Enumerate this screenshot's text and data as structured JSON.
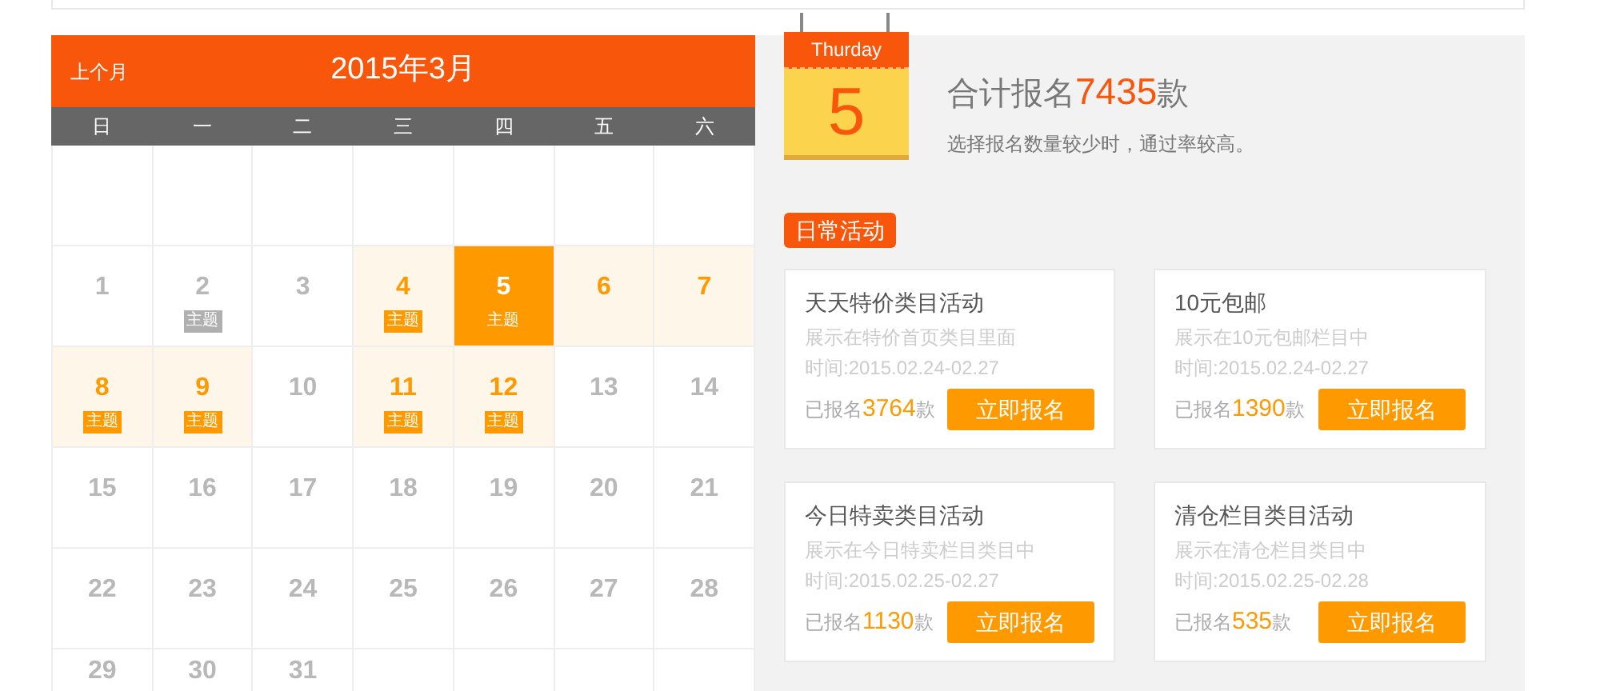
{
  "calendar": {
    "prev_link": "上个月",
    "month_title": "2015年3月",
    "weekdays": [
      "日",
      "一",
      "二",
      "三",
      "四",
      "五",
      "六"
    ],
    "weeks": [
      [
        {
          "kind": "blank"
        },
        {
          "kind": "blank"
        },
        {
          "kind": "blank"
        },
        {
          "kind": "blank"
        },
        {
          "kind": "blank"
        },
        {
          "kind": "blank"
        },
        {
          "kind": "blank"
        }
      ],
      [
        {
          "kind": "day",
          "day": "1",
          "open": false,
          "selected": false
        },
        {
          "kind": "day",
          "day": "2",
          "open": false,
          "selected": false,
          "tag": "主题"
        },
        {
          "kind": "day",
          "day": "3",
          "open": false,
          "selected": false
        },
        {
          "kind": "day",
          "day": "4",
          "open": true,
          "selected": false,
          "tag": "主题"
        },
        {
          "kind": "day",
          "day": "5",
          "selected": true,
          "tag": "主题"
        },
        {
          "kind": "day",
          "day": "6",
          "open": true,
          "selected": false
        },
        {
          "kind": "day",
          "day": "7",
          "open": true,
          "selected": false
        }
      ],
      [
        {
          "kind": "day",
          "day": "8",
          "open": true,
          "selected": false,
          "tag": "主题"
        },
        {
          "kind": "day",
          "day": "9",
          "open": true,
          "selected": false,
          "tag": "主题"
        },
        {
          "kind": "day",
          "day": "10",
          "open": false,
          "selected": false
        },
        {
          "kind": "day",
          "day": "11",
          "open": true,
          "selected": false,
          "tag": "主题"
        },
        {
          "kind": "day",
          "day": "12",
          "open": true,
          "selected": false,
          "tag": "主题"
        },
        {
          "kind": "day",
          "day": "13",
          "open": false,
          "selected": false
        },
        {
          "kind": "day",
          "day": "14",
          "open": false,
          "selected": false
        }
      ],
      [
        {
          "kind": "day",
          "day": "15",
          "open": false,
          "selected": false
        },
        {
          "kind": "day",
          "day": "16",
          "open": false,
          "selected": false
        },
        {
          "kind": "day",
          "day": "17",
          "open": false,
          "selected": false
        },
        {
          "kind": "day",
          "day": "18",
          "open": false,
          "selected": false
        },
        {
          "kind": "day",
          "day": "19",
          "open": false,
          "selected": false
        },
        {
          "kind": "day",
          "day": "20",
          "open": false,
          "selected": false
        },
        {
          "kind": "day",
          "day": "21",
          "open": false,
          "selected": false
        }
      ],
      [
        {
          "kind": "day",
          "day": "22",
          "open": false,
          "selected": false
        },
        {
          "kind": "day",
          "day": "23",
          "open": false,
          "selected": false
        },
        {
          "kind": "day",
          "day": "24",
          "open": false,
          "selected": false
        },
        {
          "kind": "day",
          "day": "25",
          "open": false,
          "selected": false
        },
        {
          "kind": "day",
          "day": "26",
          "open": false,
          "selected": false
        },
        {
          "kind": "day",
          "day": "27",
          "open": false,
          "selected": false
        },
        {
          "kind": "day",
          "day": "28",
          "open": false,
          "selected": false
        }
      ],
      [
        {
          "kind": "day",
          "day": "29",
          "open": false,
          "selected": false
        },
        {
          "kind": "day",
          "day": "30",
          "open": false,
          "selected": false
        },
        {
          "kind": "day",
          "day": "31",
          "open": false,
          "selected": false
        },
        {
          "kind": "blank"
        },
        {
          "kind": "blank"
        },
        {
          "kind": "blank"
        },
        {
          "kind": "blank"
        }
      ]
    ]
  },
  "summary": {
    "date_badge": {
      "weekday": "Thurday",
      "day": "5"
    },
    "total_label": "合计报名",
    "total_count": "7435",
    "total_unit": "款",
    "hint": "选择报名数量较少时，通过率较高。"
  },
  "section_title": "日常活动",
  "activities": [
    {
      "title": "天天特价类目活动",
      "description": "展示在特价首页类目里面",
      "time": "时间:2015.02.24-02.27",
      "signed_label": "已报名",
      "count": "3764",
      "unit": "款",
      "button": "立即报名"
    },
    {
      "title": "10元包邮",
      "description": "展示在10元包邮栏目中",
      "time": "时间:2015.02.24-02.27",
      "signed_label": "已报名",
      "count": "1390",
      "unit": "款",
      "button": "立即报名"
    },
    {
      "title": "今日特卖类目活动",
      "description": "展示在今日特卖栏目类目中",
      "time": "时间:2015.02.25-02.27",
      "signed_label": "已报名",
      "count": "1130",
      "unit": "款",
      "button": "立即报名"
    },
    {
      "title": "清仓栏目类目活动",
      "description": "展示在清仓栏目类目中",
      "time": "时间:2015.02.25-02.28",
      "signed_label": "已报名",
      "count": "535",
      "unit": "款",
      "button": "立即报名"
    }
  ]
}
